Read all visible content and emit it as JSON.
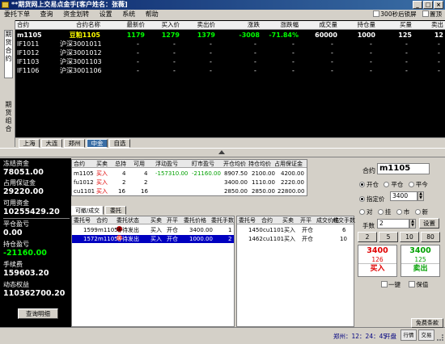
{
  "window": {
    "title": "**期货网上交易点金手[客户姓名：张薇]",
    "min": "_",
    "max": "□",
    "close": "×"
  },
  "menu": [
    "委托下单",
    "查询",
    "资金划转",
    "设置",
    "系统",
    "帮助"
  ],
  "menu_right": {
    "lock_label": "300秒后锁屏",
    "top_label": "置顶"
  },
  "side_tabs": {
    "quotes": "期货合约",
    "portfolio": "期货组合"
  },
  "quote_header": [
    "合约",
    "合约名称",
    "最新价",
    "买入价",
    "卖出价",
    "涨跌",
    "涨跌幅",
    "成交量",
    "持仓量",
    "买量",
    "卖出"
  ],
  "quote_rows": [
    {
      "code": "m1105",
      "name": "豆粕1105",
      "last": "1179",
      "bid": "1279",
      "ask": "1379",
      "chg": "-3008",
      "pct": "-71.84%",
      "vol": "60000",
      "oi": "1000",
      "bidvol": "125",
      "askvol": "12"
    },
    {
      "code": "IF1011",
      "name": "沪深3001011",
      "last": "-",
      "bid": "-",
      "ask": "-",
      "chg": "-",
      "pct": "-",
      "vol": "-",
      "oi": "-",
      "bidvol": "-",
      "askvol": "-"
    },
    {
      "code": "IF1012",
      "name": "沪深3001012",
      "last": "-",
      "bid": "-",
      "ask": "-",
      "chg": "-",
      "pct": "-",
      "vol": "-",
      "oi": "-",
      "bidvol": "-",
      "askvol": "-"
    },
    {
      "code": "IF1103",
      "name": "沪深3001103",
      "last": "-",
      "bid": "-",
      "ask": "-",
      "chg": "-",
      "pct": "-",
      "vol": "-",
      "oi": "-",
      "bidvol": "-",
      "askvol": "-"
    },
    {
      "code": "IF1106",
      "name": "沪深3001106",
      "last": "-",
      "bid": "-",
      "ask": "-",
      "chg": "-",
      "pct": "-",
      "vol": "-",
      "oi": "-",
      "bidvol": "-",
      "askvol": "-"
    }
  ],
  "exchange_tabs": [
    "上海",
    "大连",
    "郑州",
    "中金",
    "自选"
  ],
  "account": [
    {
      "label": "冻结资金",
      "value": "78051.00"
    },
    {
      "label": "占用保证金",
      "value": "29220.00"
    },
    {
      "label": "可用资金",
      "value": "10255429.20"
    },
    {
      "label": "平仓盈亏",
      "value": "0.00"
    },
    {
      "label": "持仓盈亏",
      "value": "-21160.00"
    },
    {
      "label": "手续费",
      "value": "159603.20"
    },
    {
      "label": "动态权益",
      "value": "110362700.20"
    }
  ],
  "query_detail_button": "查询明细",
  "positions": {
    "header": [
      "合约",
      "买卖",
      "总持",
      "可用",
      "浮动盈亏",
      "盯市盈亏",
      "开仓均价",
      "持仓均价",
      "占用保证金"
    ],
    "rows": [
      {
        "code": "m1105",
        "side": "买入",
        "total": "4",
        "avail": "4",
        "float": "-157310.00",
        "mtm": "-21160.00",
        "open": "8907.50",
        "hold": "2100.00",
        "margin": "4200.00"
      },
      {
        "code": "fu1012",
        "side": "买入",
        "total": "2",
        "avail": "2",
        "float": "",
        "mtm": "",
        "open": "3400.00",
        "hold": "1110.00",
        "margin": "2220.00"
      },
      {
        "code": "cu1101",
        "side": "买入",
        "total": "16",
        "avail": "16",
        "float": "",
        "mtm": "",
        "open": "2850.00",
        "hold": "2850.00",
        "margin": "22800.00"
      }
    ]
  },
  "order_tabs": [
    "可撤/成交",
    "委托"
  ],
  "orders_left": {
    "header": [
      "委托号",
      "合约",
      "委托状态",
      "买卖",
      "开平",
      "委托价格",
      "委托手数"
    ],
    "rows": [
      {
        "id": "1599",
        "code": "m1105",
        "status": "等待发出",
        "side": "买入",
        "oc": "开仓",
        "price": "3400.00",
        "qty": "1"
      },
      {
        "id": "1572",
        "code": "m1105",
        "status": "等待发出",
        "side": "买入",
        "oc": "开仓",
        "price": "1000.00",
        "qty": "2"
      }
    ]
  },
  "orders_right": {
    "header": [
      "委托号",
      "合约",
      "买卖",
      "开平",
      "成交价格",
      "成交手数"
    ],
    "rows": [
      {
        "id": "1450",
        "code": "cu1101",
        "side": "买入",
        "oc": "开仓",
        "price": "",
        "qty": "6"
      },
      {
        "id": "1462",
        "code": "cu1101",
        "side": "买入",
        "oc": "开仓",
        "price": "",
        "qty": "10"
      }
    ]
  },
  "order_panel": {
    "contract_label": "合约",
    "contract_value": "m1105",
    "oc_options": [
      "开仓",
      "平仓",
      "平今"
    ],
    "price_label": "指定价",
    "price_value": "3400",
    "price_modes": [
      "对",
      "挂",
      "市",
      "新"
    ],
    "qty_label": "手数",
    "qty_value": "2",
    "settings_button": "设置",
    "qty_presets": [
      "2",
      "5",
      "10",
      "80"
    ],
    "buy": {
      "price": "3400",
      "qty": "126",
      "label": "买入"
    },
    "sell": {
      "price": "3400",
      "qty": "125",
      "label": "卖出"
    },
    "one_key": "一键",
    "protect": "保值"
  },
  "status": {
    "button": "免费条款",
    "rows_label": "行情",
    "kline_label": "交易",
    "time": "郑州：12：24：45",
    "state": "开盘"
  }
}
